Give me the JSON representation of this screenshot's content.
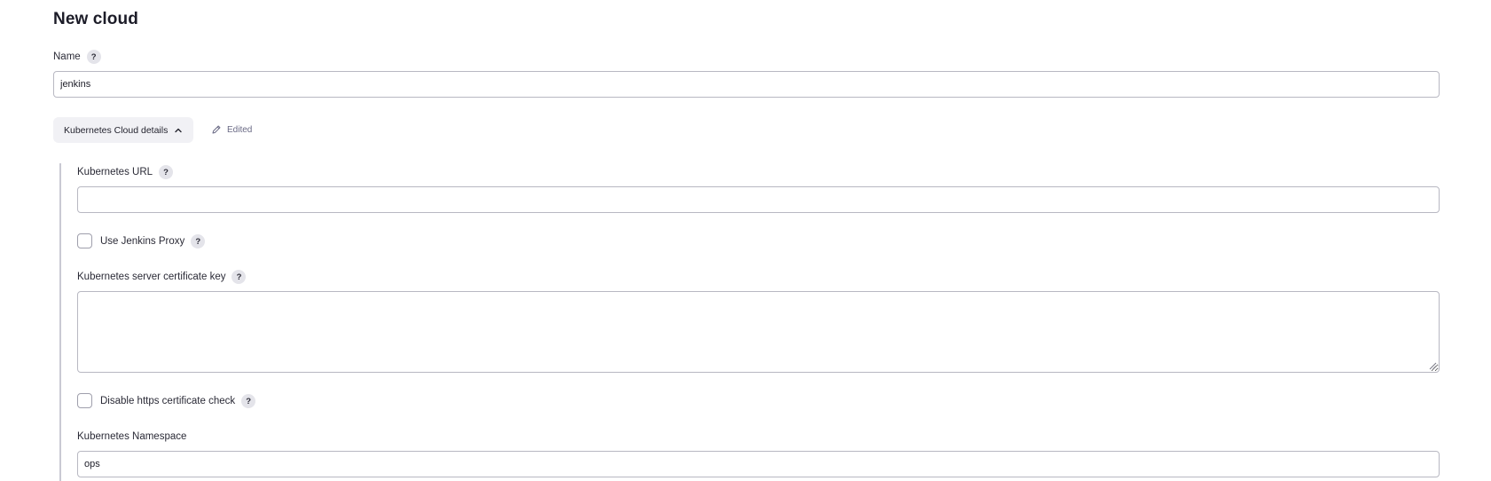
{
  "page": {
    "title": "New cloud"
  },
  "help_glyph": "?",
  "name_field": {
    "label": "Name",
    "value": "jenkins"
  },
  "section": {
    "label": "Kubernetes Cloud details",
    "expanded": true,
    "edited_label": "Edited",
    "edited_icon": "pencil-icon"
  },
  "kubernetes_url": {
    "label": "Kubernetes URL",
    "value": ""
  },
  "use_jenkins_proxy": {
    "label": "Use Jenkins Proxy",
    "checked": false
  },
  "server_certificate_key": {
    "label": "Kubernetes server certificate key",
    "value": ""
  },
  "disable_https_check": {
    "label": "Disable https certificate check",
    "checked": false
  },
  "namespace": {
    "label": "Kubernetes Namespace",
    "value": "ops"
  },
  "colors": {
    "background": "#ffffff",
    "text": "#1e1e2a",
    "input_border": "#b8b8c2",
    "help_bg": "#e4e4ea",
    "section_toggle_bg": "#f1f1f5",
    "edited_text": "#6a6a85",
    "section_rule": "#c9c9d3"
  }
}
